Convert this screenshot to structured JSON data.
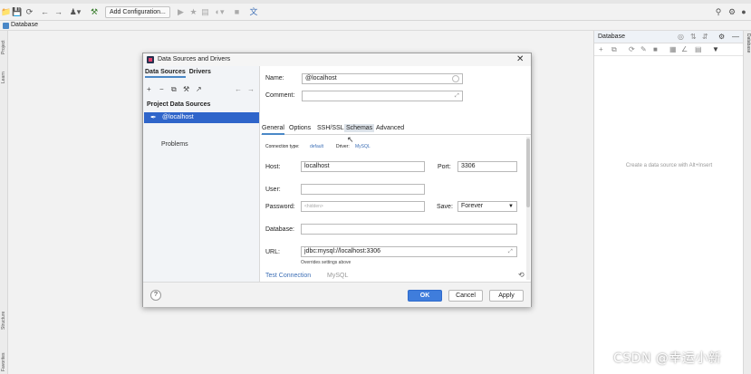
{
  "toolbar": {
    "add_configuration": "Add Configuration...",
    "icons": [
      "folder-icon",
      "save-icon",
      "sync-icon",
      "back-icon",
      "forward-icon",
      "vcs-icon",
      "build-icon",
      "run-icon",
      "debug-icon",
      "coverage-icon",
      "profile-icon",
      "stop-icon",
      "translate-icon",
      "search-icon",
      "settings-icon",
      "avatar-icon"
    ]
  },
  "breadcrumb": {
    "label": "Database"
  },
  "left_strip": {
    "project": "Project",
    "learn": "Learn",
    "structure": "Structure",
    "favorites": "Favorites"
  },
  "right_strip": {
    "database": "Database"
  },
  "db_panel": {
    "title": "Database",
    "empty_text": "Create a data source with Alt+Insert"
  },
  "dialog": {
    "title": "Data Sources and Drivers",
    "left": {
      "tab_data_sources": "Data Sources",
      "tab_drivers": "Drivers",
      "section": "Project Data Sources",
      "selected_item": "@localhost",
      "problems": "Problems"
    },
    "name_label": "Name:",
    "name_value": "@localhost",
    "comment_label": "Comment:",
    "tabs": [
      "General",
      "Options",
      "SSH/SSL",
      "Schemas",
      "Advanced"
    ],
    "connection_type_label": "Connection type:",
    "connection_type_value": "default",
    "driver_label": "Driver:",
    "driver_value": "MySQL",
    "host_label": "Host:",
    "host_value": "localhost",
    "port_label": "Port:",
    "port_value": "3306",
    "user_label": "User:",
    "user_value": "",
    "password_label": "Password:",
    "password_placeholder": "<hidden>",
    "save_label": "Save:",
    "save_value": "Forever",
    "database_label": "Database:",
    "database_value": "",
    "url_label": "URL:",
    "url_value": "jdbc:mysql://localhost:3306",
    "url_hint": "Overrides settings above",
    "test_connection": "Test Connection",
    "test_driver": "MySQL",
    "ok": "OK",
    "cancel": "Cancel",
    "apply": "Apply",
    "help": "?"
  },
  "watermark": "CSDN @幸运小新"
}
